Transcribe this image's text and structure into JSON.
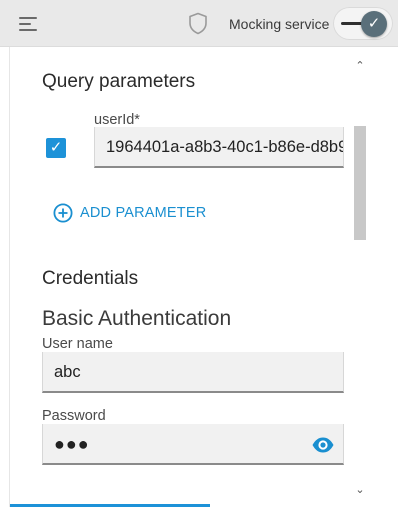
{
  "header": {
    "mocking_label": "Mocking service",
    "toggle_on": true
  },
  "query_parameters": {
    "title": "Query parameters",
    "params": [
      {
        "label": "userId*",
        "value": "1964401a-a8b3-40c1-b86e-d8b9",
        "enabled": true
      }
    ],
    "add_label": "ADD PARAMETER"
  },
  "credentials": {
    "title": "Credentials",
    "method": "Basic Authentication",
    "username_label": "User name",
    "username_value": "abc",
    "password_label": "Password",
    "password_value": "●●●"
  },
  "icons": {
    "menu": "hamburger-icon",
    "status": "shield-icon",
    "toggle": "check-icon",
    "add": "plus-circle-icon",
    "reveal": "eye-icon"
  },
  "colors": {
    "accent": "#1d92d8",
    "header_bg": "#e9e9e9",
    "toggle_knob": "#5a6f7a"
  }
}
